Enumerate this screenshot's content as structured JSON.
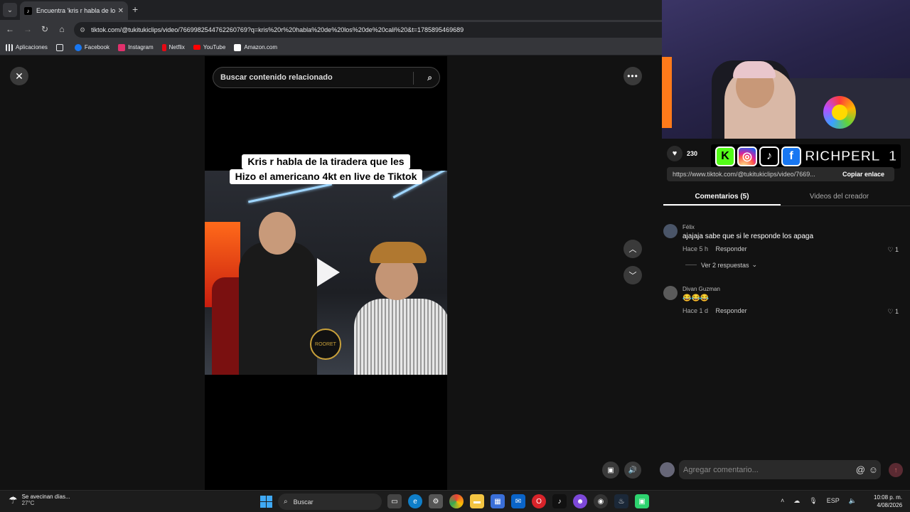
{
  "browser": {
    "tab_title": "Encuentra 'kris r habla de los d...",
    "url": "tiktok.com/@tukitukiclips/video/7669982544762260769?q=kris%20r%20habla%20de%20los%20de%20cali%20&t=1785895469689",
    "bookmarks": [
      {
        "label": "Aplicaciones",
        "color": "#e8eaed"
      },
      {
        "label": "Facebook",
        "color": "#1877f2"
      },
      {
        "label": "Instagram",
        "color": "#e1306c"
      },
      {
        "label": "Netflix",
        "color": "#e50914"
      },
      {
        "label": "YouTube",
        "color": "#ff0000"
      },
      {
        "label": "Amazon.com",
        "color": "#ffffff"
      }
    ]
  },
  "viewer": {
    "search_placeholder": "Buscar contenido relacionado",
    "caption_line1": "Kris r habla de la tiradera que les",
    "caption_line2": "Hizo el americano 4kt en live de Tiktok",
    "badge_text": "ROORET"
  },
  "panel": {
    "likes": "230",
    "social_handle": "RICHPERL_1",
    "share_url": "https://www.tiktok.com/@tukitukiclips/video/7669...",
    "copy_label": "Copiar enlace",
    "tab_comments": "Comentarios (5)",
    "tab_creator": "Videos del creador",
    "comments": [
      {
        "user": "Félix",
        "text": "ajajaja sabe que si le responde los apaga",
        "time": "Hace 5 h",
        "reply": "Responder",
        "likes": "1",
        "replies_label": "Ver 2 respuestas"
      },
      {
        "user": "Divan Guzman",
        "text": "😂😂😂",
        "time": "Hace 1 d",
        "reply": "Responder",
        "likes": "1"
      }
    ],
    "composer_placeholder": "Agregar comentario..."
  },
  "taskbar": {
    "weather_line1": "Se avecinan días...",
    "weather_line2": "27°C",
    "search_label": "Buscar",
    "lang": "ESP",
    "time": "10:08 p. m.",
    "date": "4/08/2026"
  },
  "colors": {
    "accent_kick": "#53fc18",
    "facebook": "#1877f2",
    "background": "#121212"
  }
}
